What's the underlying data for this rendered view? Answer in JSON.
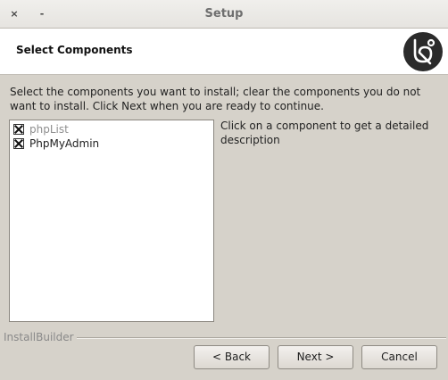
{
  "window": {
    "title": "Setup",
    "close_glyph": "×",
    "minimize_glyph": "-"
  },
  "header": {
    "title": "Select Components",
    "logo_icon": "bitnami-logo-icon"
  },
  "intro_text": "Select the components you want to install; clear the components you do not want to install. Click Next when you are ready to continue.",
  "components": [
    {
      "label": "phpList",
      "checked": true
    },
    {
      "label": "PhpMyAdmin",
      "checked": true
    }
  ],
  "description_text": "Click on a component to get a detailed description",
  "footer": {
    "brand": "InstallBuilder",
    "back_label": "< Back",
    "next_label": "Next >",
    "cancel_label": "Cancel"
  }
}
